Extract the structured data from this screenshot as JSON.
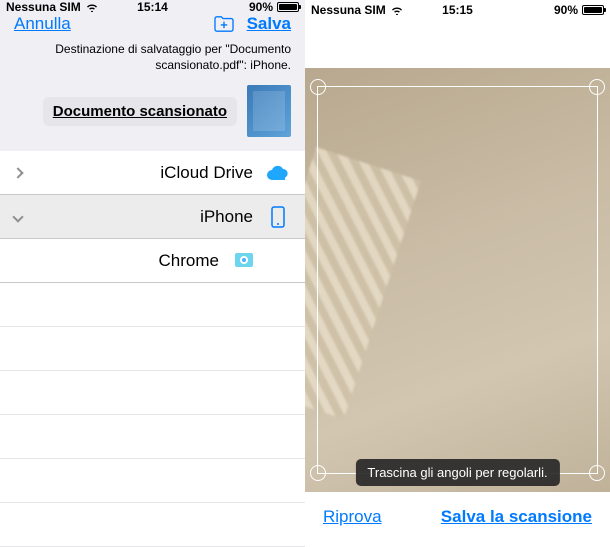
{
  "left": {
    "status": {
      "carrier": "Nessuna SIM",
      "time": "15:14",
      "battery": "90%"
    },
    "nav": {
      "cancel": "Annulla",
      "save": "Salva"
    },
    "info": {
      "line1": "Destinazione di salvataggio per \"Documento",
      "line2": "scansionato.pdf\": iPhone."
    },
    "doc_name": "Documento scansionato",
    "locations": {
      "icloud": "iCloud Drive",
      "iphone": "iPhone",
      "chrome": "Chrome"
    }
  },
  "right": {
    "status": {
      "carrier": "Nessuna SIM",
      "time": "15:15",
      "battery": "90%"
    },
    "toast": "Trascina gli angoli per regolarli.",
    "retry": "Riprova",
    "save": "Salva la scansione"
  }
}
